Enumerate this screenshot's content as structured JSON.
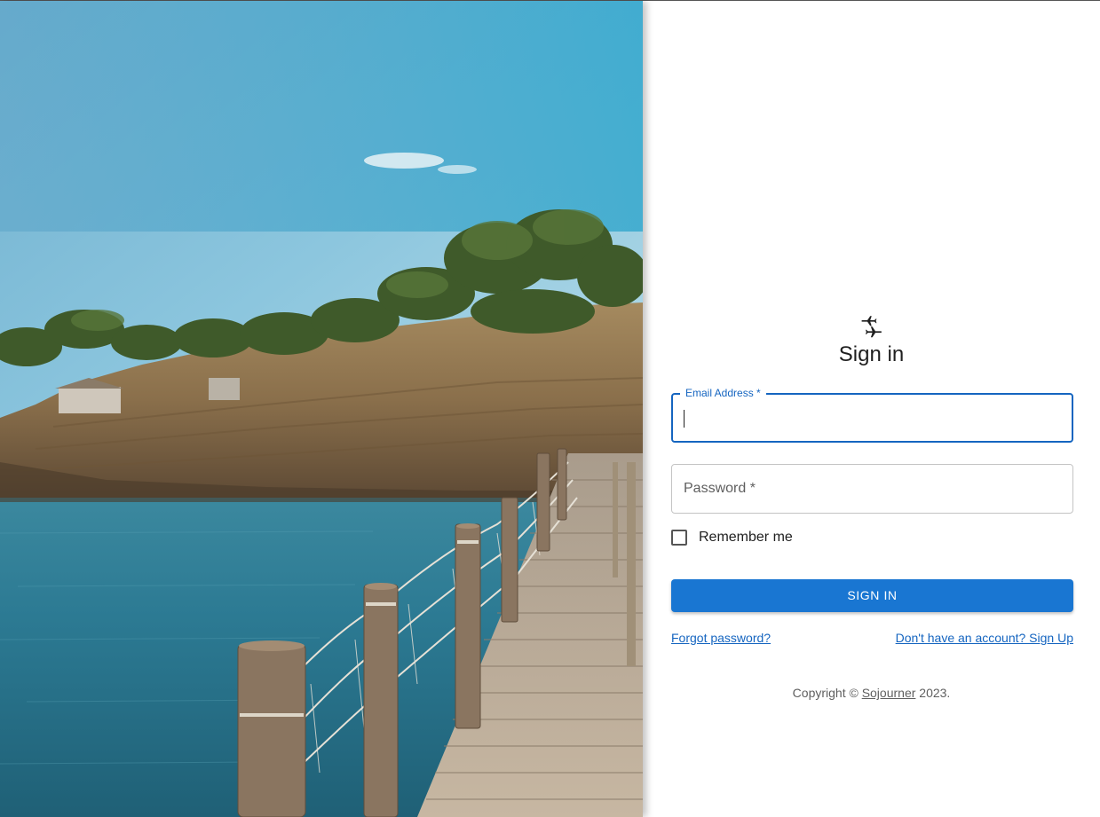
{
  "form": {
    "title": "Sign in",
    "logo_icon": "airplanes-icon",
    "email": {
      "label": "Email Address",
      "required_mark": "*",
      "value": ""
    },
    "password": {
      "label": "Password",
      "required_mark": "*",
      "value": ""
    },
    "remember": {
      "label": "Remember me",
      "checked": false
    },
    "submit_label": "SIGN IN",
    "forgot_link": "Forgot password?",
    "signup_link": "Don't have an account? Sign Up"
  },
  "footer": {
    "prefix": "Copyright ©",
    "brand": "Sojourner",
    "suffix": "2023."
  },
  "colors": {
    "primary": "#1976d2",
    "link": "#1565c0",
    "text": "#1f1f1f",
    "muted": "#5f5f5f"
  }
}
